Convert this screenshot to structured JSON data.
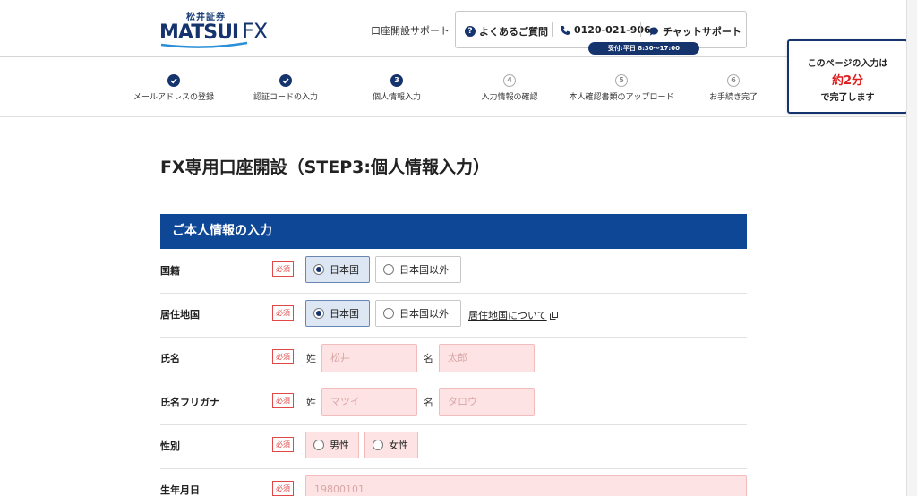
{
  "header": {
    "logo_kanji": "松井証券",
    "logo_brand": "MATSUI",
    "logo_fx": "FX",
    "support_link": "口座開設サポート",
    "faq": "よくあるご質問",
    "phone": "0120-021-906",
    "chat": "チャットサポート",
    "hours": "受付:平日 8:30〜17:00"
  },
  "steps": [
    {
      "num": "1",
      "label": "メールアドレスの登録",
      "state": "done"
    },
    {
      "num": "2",
      "label": "認証コードの入力",
      "state": "done"
    },
    {
      "num": "3",
      "label": "個人情報入力",
      "state": "current"
    },
    {
      "num": "4",
      "label": "入力情報の確認",
      "state": "todo"
    },
    {
      "num": "5",
      "label": "本人確認書類のアップロード",
      "state": "todo"
    },
    {
      "num": "6",
      "label": "お手続き完了",
      "state": "todo"
    }
  ],
  "time_box": {
    "line1": "このページの入力は",
    "line2": "約2分",
    "line3": "で完了します"
  },
  "page_title": "FX専用口座開設（STEP3:個人情報入力）",
  "section_title": "ご本人情報の入力",
  "required": "必須",
  "form": {
    "nationality": {
      "label": "国籍",
      "opt1": "日本国",
      "opt2": "日本国以外"
    },
    "residence": {
      "label": "居住地国",
      "opt1": "日本国",
      "opt2": "日本国以外",
      "link": "居住地国について"
    },
    "name": {
      "label": "氏名",
      "sei": "姓",
      "mei": "名",
      "sei_ph": "松井",
      "mei_ph": "太郎"
    },
    "kana": {
      "label": "氏名フリガナ",
      "sei": "姓",
      "mei": "名",
      "sei_ph": "マツイ",
      "mei_ph": "タロウ"
    },
    "gender": {
      "label": "性別",
      "male": "男性",
      "female": "女性"
    },
    "birth": {
      "label": "生年月日",
      "ph": "19800101"
    }
  },
  "colors": {
    "brand_navy": "#15346e",
    "section_blue": "#0f4797",
    "required_red": "#e04848",
    "input_pink": "#fde3e3"
  }
}
